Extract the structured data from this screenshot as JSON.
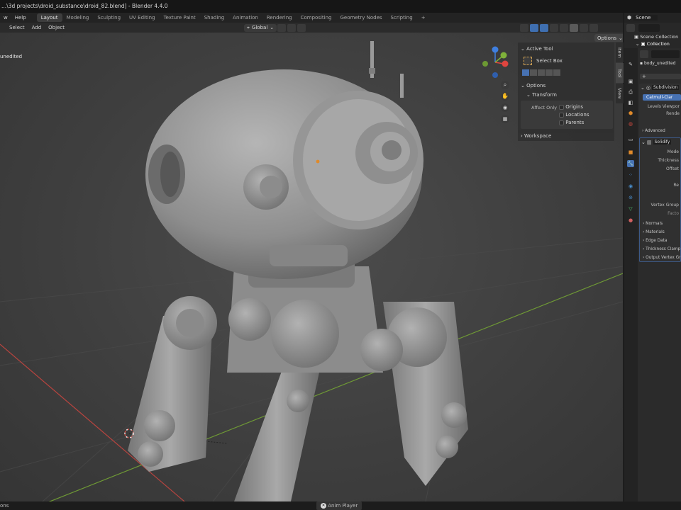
{
  "window": {
    "title": "...\\3d projects\\droid_substance\\droid_82.blend] - Blender 4.4.0"
  },
  "menu": {
    "items": [
      "w",
      "Help"
    ]
  },
  "workspaces": {
    "tabs": [
      "Layout",
      "Modeling",
      "Sculpting",
      "UV Editing",
      "Texture Paint",
      "Shading",
      "Animation",
      "Rendering",
      "Compositing",
      "Geometry Nodes",
      "Scripting"
    ],
    "add": "+"
  },
  "viewport_header": {
    "items": [
      "Select",
      "Add",
      "Object"
    ],
    "orientation": "Global",
    "options": "Options"
  },
  "viewport": {
    "object_label": "unedited"
  },
  "n_panel": {
    "active_tool": "Active Tool",
    "select_box": "Select Box",
    "options": "Options",
    "transform": "Transform",
    "affect_only": "Affect Only",
    "origins": "Origins",
    "locations": "Locations",
    "parents": "Parents",
    "workspace": "Workspace",
    "tabs": [
      "Item",
      "Tool",
      "View"
    ]
  },
  "scene": {
    "name": "Scene"
  },
  "outliner": {
    "scene_collection": "Scene Collection",
    "collection": "Collection"
  },
  "properties": {
    "object_name": "body_unedited",
    "subdivision": {
      "name": "Subdivision",
      "method": "Catmull-Clar",
      "levels_viewport": "Levels Viewpor",
      "render": "Rende",
      "advanced": "Advanced"
    },
    "solidify": {
      "name": "Solidify",
      "fields": [
        "Mode",
        "Thickness",
        "Offset",
        "Re",
        "Vertex Group",
        "Facto"
      ],
      "panels": [
        "Normals",
        "Materials",
        "Edge Data",
        "Thickness Clamp",
        "Output Vertex Gr"
      ]
    }
  },
  "status": {
    "left": "ons",
    "anim_player": "Anim Player"
  },
  "colors": {
    "accent_blue": "#4772b3",
    "x_axis": "#e0453f",
    "y_axis": "#7fb13a",
    "z_axis": "#3f7fe0",
    "origin_dot": "#e08a2a"
  }
}
